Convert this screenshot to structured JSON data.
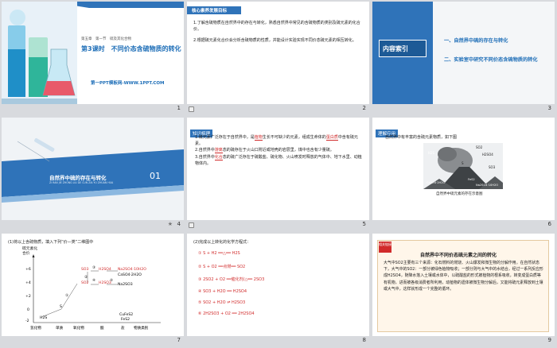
{
  "slides": [
    {
      "number": "1",
      "chapter_line": "第五章　第一节　硫及其化合物",
      "title": "第3课时　不同价态含硫物质的转化",
      "site": "第一PPT模板网-WWW.1PPT.COM"
    },
    {
      "number": "2",
      "header": "核心素养发展目标",
      "goals": [
        "1.了解含硫物质在自然界中的存在与转化，熟悉自然界中常见的含硫物质的类别及硫元素的化合价。",
        "2.根据硫元素化合价会分析含硫物质的性质，并能设计实验实现不同价态硫元素的相互转化。"
      ]
    },
    {
      "number": "3",
      "index_title": "内容索引",
      "items": [
        "一、自然界中硫的存在与转化",
        "二、实验室中研究不同价态含硫物质的转化"
      ]
    },
    {
      "number": "4",
      "section_title": "自然界中硫的存在与转化",
      "pinyin": "ZI RAN JIE ZHONG LIU DE CUN ZAI YU ZHUAN HUA",
      "section_no": "01"
    },
    {
      "number": "5",
      "tag": "知识梳理",
      "lines": [
        [
          "1.硫元素广泛存在于自然界中，是",
          "植物",
          "生长不可缺少的元素，组成生命体的",
          "蛋白质",
          "中含有硫元素。"
        ],
        [
          "2.自然界中",
          "游离",
          "态的硫存在于火山口附近或地壳的岩层里，煤中也含有少量硫。"
        ],
        [
          "3.自然界中",
          "化合",
          "态的硫广泛存在于硫酸盐、硫化物、火山喷发时释放的气体中、地下水里、动植物体内。"
        ]
      ]
    },
    {
      "number": "6",
      "tag": "理解应用",
      "question": "自然界中有丰富的含硫元素物质，如下图",
      "caption": "自然界中硫元素的存在示意图",
      "labels": [
        "H2S",
        "SO2",
        "S",
        "H2SO4",
        "SO3",
        "CaSO4·2H2O",
        "FeS2",
        "Na2SO4·10H2O"
      ]
    },
    {
      "number": "7",
      "question": "(1)将以上含硫物质，填入下列“价—类”二维图中",
      "ylabel": "硫元素化合价",
      "y_ticks": [
        "+6",
        "+4",
        "+2",
        "0",
        "-2"
      ],
      "x_ticks": [
        "氢化物",
        "单质",
        "氧化物",
        "酸",
        "盐",
        "物质类别"
      ],
      "points": {
        "p1": "SO3",
        "p2": "H2SO4",
        "p3": "Na2SO4·10H2O",
        "p4": "CaSO4·2H2O",
        "p5": "SO2",
        "p6": "H2SO3",
        "p7": "Na2SO3",
        "p8": "S",
        "p9": "H2S",
        "p10": "CuFeS2",
        "p11": "FeS2"
      },
      "markers": [
        "①",
        "②",
        "③",
        "④",
        "⑤"
      ]
    },
    {
      "number": "8",
      "question": "(2)完成以上转化的化学方程式：",
      "equations": [
        "① S + H2 ══△══ H2S",
        "② S + O2 ══点燃══ SO2",
        "③ 2SO2 + O2 ══催化剂/△══ 2SO3",
        "④ SO3 + H2O ══ H2SO4",
        "⑤ SO2 + H2O ⇌ H2SO3",
        "⑥ 2H2SO3 + O2 ══ 2H2SO4"
      ]
    },
    {
      "number": "9",
      "badge": "相关链接",
      "title": "自然界中不同价态硫元素之间的转化",
      "body": "大气中SO2主要有三个来源：化石燃料的燃烧、火山爆发和微生物的分解作用。在自然状态下，大气中的SO2：一部分被绿色植物吸收；一部分则与大气中的水结合，经过一系列反应形成H2SO4，随降水落入土壤或水体中，以硫酸盐的形式被植物的根系吸收，转变成蛋白质等有机物，进而被各级消费者所利用，动植物的遗体被微生物分解后，又能将硫元素释放到土壤或大气中，这样就形成一个完整的循环。"
    }
  ]
}
